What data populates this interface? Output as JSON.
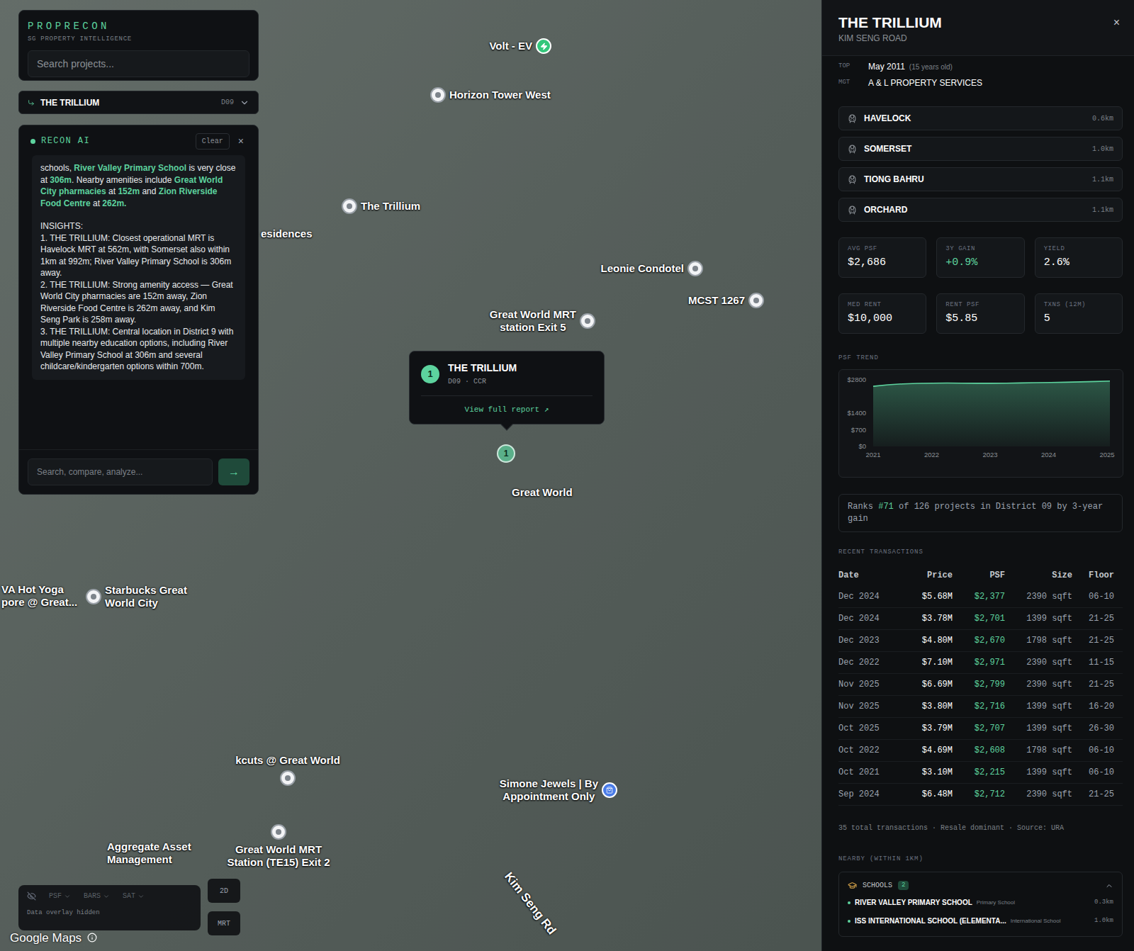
{
  "app": {
    "logo": "PROPRECON",
    "tagline": "SG PROPERTY INTELLIGENCE"
  },
  "search": {
    "placeholder": "Search projects..."
  },
  "project_selector": {
    "name": "THE TRILLIUM",
    "district": "D09"
  },
  "recon_ai": {
    "title": "RECON AI",
    "clear": "Clear",
    "close": "×",
    "message": [
      {
        "text": "schools, ",
        "highlight": false
      },
      {
        "text": "River Valley Primary School",
        "highlight": true
      },
      {
        "text": " is very close at ",
        "highlight": false
      },
      {
        "text": "306m",
        "highlight": true
      },
      {
        "text": ". Nearby amenities include ",
        "highlight": false
      },
      {
        "text": "Great World City pharmacies",
        "highlight": true
      },
      {
        "text": " at ",
        "highlight": false
      },
      {
        "text": "152m",
        "highlight": true
      },
      {
        "text": " and ",
        "highlight": false
      },
      {
        "text": "Zion Riverside Food Centre",
        "highlight": true
      },
      {
        "text": " at ",
        "highlight": false
      },
      {
        "text": "262m.",
        "highlight": true
      }
    ],
    "insights_title": "INSIGHTS:",
    "insights": [
      "1. THE TRILLIUM: Closest operational MRT is Havelock MRT at 562m, with Somerset also within 1km at 992m; River Valley Primary School is 306m away.",
      "2. THE TRILLIUM: Strong amenity access — Great World City pharmacies are 152m away, Zion Riverside Food Centre is 262m away, and Kim Seng Park is 258m away.",
      "3. THE TRILLIUM: Central location in District 9 with multiple nearby education options, including River Valley Primary School at 306m and several childcare/kindergarten options within 700m."
    ],
    "input_placeholder": "Search, compare, analyze...",
    "send": "→"
  },
  "map": {
    "pins": [
      {
        "lines": [
          "Volt - EV"
        ],
        "kind": "ev"
      },
      {
        "lines": [
          "Horizon Tower West"
        ],
        "kind": "place"
      },
      {
        "lines": [
          "The Trillium"
        ],
        "kind": "place"
      },
      {
        "lines": [
          "esidences"
        ],
        "kind": "label"
      },
      {
        "lines": [
          "Leonie Condotel"
        ],
        "kind": "place"
      },
      {
        "lines": [
          "MCST 1267"
        ],
        "kind": "place"
      },
      {
        "lines": [
          "Great World MRT",
          "station Exit 5"
        ],
        "kind": "place"
      },
      {
        "lines": [
          "Great World"
        ],
        "kind": "label"
      },
      {
        "lines": [
          "VA Hot Yoga",
          "pore @ Great..."
        ],
        "kind": "label"
      },
      {
        "lines": [
          "Starbucks Great",
          "World City"
        ],
        "kind": "place"
      },
      {
        "lines": [
          "kcuts @ Great World"
        ],
        "kind": "place"
      },
      {
        "lines": [
          "Simone Jewels | By",
          "Appointment Only"
        ],
        "kind": "shop"
      },
      {
        "lines": [
          "Aggregate Asset",
          "Management"
        ],
        "kind": "label"
      },
      {
        "lines": [
          "Great World MRT",
          "Station (TE15) Exit 2"
        ],
        "kind": "place"
      }
    ],
    "road_label": "Kim Seng Rd",
    "cluster_marker": "1",
    "popup": {
      "badge": "1",
      "name": "THE TRILLIUM",
      "meta": "D09 · CCR",
      "link": "View full report ↗"
    },
    "controls": {
      "toggles": [
        {
          "label": "PSF",
          "disabled": true
        },
        {
          "label": "BARS",
          "disabled": true
        },
        {
          "label": "SAT",
          "disabled": true
        }
      ],
      "status": "Data overlay hidden",
      "buttons": [
        "2D",
        "MRT"
      ]
    },
    "attribution": "Google Maps"
  },
  "detail": {
    "title": "THE TRILLIUM",
    "address": "KIM SENG ROAD",
    "close": "×",
    "facts": [
      {
        "key": "TOP",
        "value": "May 2011",
        "note": "(15 years old)"
      },
      {
        "key": "MGT",
        "value": "A & L PROPERTY SERVICES"
      }
    ],
    "mrt": [
      {
        "name": "HAVELOCK",
        "distance": "0.6km"
      },
      {
        "name": "SOMERSET",
        "distance": "1.0km"
      },
      {
        "name": "TIONG BAHRU",
        "distance": "1.1km"
      },
      {
        "name": "ORCHARD",
        "distance": "1.1km"
      }
    ],
    "stats": [
      {
        "label": "AVG PSF",
        "value": "$2,686",
        "positive": false
      },
      {
        "label": "3Y GAIN",
        "value": "+0.9%",
        "positive": true
      },
      {
        "label": "YIELD",
        "value": "2.6%",
        "positive": false
      },
      {
        "label": "MED RENT",
        "value": "$10,000",
        "positive": false
      },
      {
        "label": "RENT PSF",
        "value": "$5.85",
        "positive": false
      },
      {
        "label": "TXNS (12M)",
        "value": "5",
        "positive": false
      }
    ],
    "psf_trend": {
      "title": "PSF TREND",
      "y_ticks": [
        {
          "label": "$2800",
          "value": 2800
        },
        {
          "label": "$1400",
          "value": 1400
        },
        {
          "label": "$700",
          "value": 700
        },
        {
          "label": "$0",
          "value": 0
        }
      ],
      "x_ticks": [
        "2021",
        "2022",
        "2023",
        "2024",
        "2025"
      ],
      "values": [
        2530,
        2590,
        2630,
        2650,
        2660,
        2665,
        2660,
        2655,
        2655,
        2660,
        2670,
        2680,
        2690,
        2700,
        2715,
        2730,
        2750
      ]
    },
    "rank": [
      {
        "text": "Ranks ",
        "highlight": false
      },
      {
        "text": "#71",
        "highlight": true
      },
      {
        "text": " of 126 projects in District 09 by 3-year gain",
        "highlight": false
      }
    ],
    "transactions": {
      "title": "RECENT TRANSACTIONS",
      "columns": [
        "Date",
        "Price",
        "PSF",
        "Size",
        "Floor"
      ],
      "rows": [
        [
          "Dec 2024",
          "$5.68M",
          "$2,377",
          "2390 sqft",
          "06-10"
        ],
        [
          "Dec 2024",
          "$3.78M",
          "$2,701",
          "1399 sqft",
          "21-25"
        ],
        [
          "Dec 2023",
          "$4.80M",
          "$2,670",
          "1798 sqft",
          "21-25"
        ],
        [
          "Dec 2022",
          "$7.10M",
          "$2,971",
          "2390 sqft",
          "11-15"
        ],
        [
          "Nov 2025",
          "$6.69M",
          "$2,799",
          "2390 sqft",
          "21-25"
        ],
        [
          "Nov 2025",
          "$3.80M",
          "$2,716",
          "1399 sqft",
          "16-20"
        ],
        [
          "Oct 2025",
          "$3.79M",
          "$2,707",
          "1399 sqft",
          "26-30"
        ],
        [
          "Oct 2022",
          "$4.69M",
          "$2,608",
          "1798 sqft",
          "06-10"
        ],
        [
          "Oct 2021",
          "$3.10M",
          "$2,215",
          "1399 sqft",
          "06-10"
        ],
        [
          "Sep 2024",
          "$6.48M",
          "$2,712",
          "2390 sqft",
          "21-25"
        ]
      ],
      "footer": "35 total transactions · Resale dominant · Source: URA"
    },
    "nearby": {
      "title": "NEARBY (WITHIN 1KM)",
      "groups": [
        {
          "name": "SCHOOLS",
          "count": "2",
          "expanded": true,
          "items": [
            {
              "name": "RIVER VALLEY PRIMARY SCHOOL",
              "type": "Primary School",
              "distance": "0.3km"
            },
            {
              "name": "ISS INTERNATIONAL SCHOOL (ELEMENTA...",
              "type": "International School",
              "distance": "1.0km"
            }
          ]
        }
      ]
    }
  }
}
